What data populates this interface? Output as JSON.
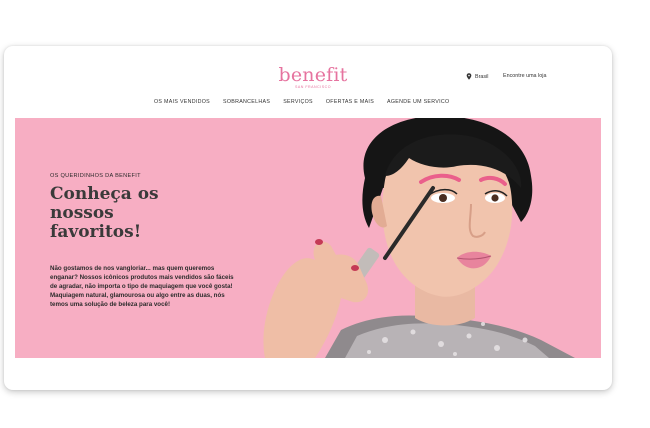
{
  "brand": {
    "logo_text": "benefit",
    "logo_sub": "SAN FRANCISCO",
    "accent_color": "#e6739f"
  },
  "utility": {
    "region_icon": "location-pin-icon",
    "region_label": "Brasil",
    "store_label": "Encontre uma loja"
  },
  "nav": {
    "items": [
      {
        "label": "OS MAIS VENDIDOS"
      },
      {
        "label": "SOBRANCELHAS"
      },
      {
        "label": "SERVIÇOS"
      },
      {
        "label": "OFERTAS E MAIS"
      },
      {
        "label": "AGENDE UM SERVICO"
      }
    ]
  },
  "hero": {
    "background_color": "#f7aec3",
    "eyebrow": "OS QUERIDINHOS DA BENEFIT",
    "headline_line1": "Conheça os",
    "headline_line2": "nossos",
    "headline_line3": "favoritos!",
    "body": "Não gostamos de nos vangloriar... mas quem queremos enganar? Nossos icônicos produtos mais vendidos são fáceis de agradar, não importa o tipo de maquiagem que você gosta! Maquiagem natural, glamourosa ou algo entre as duas, nós temos uma solução de beleza para você!"
  }
}
